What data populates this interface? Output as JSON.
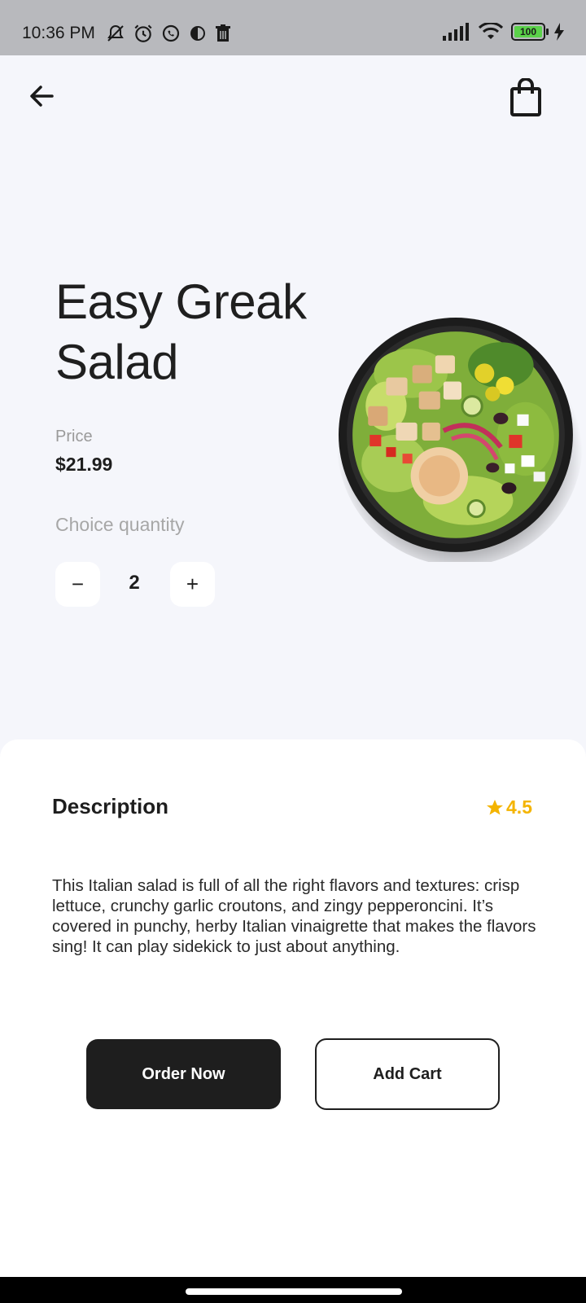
{
  "status_bar": {
    "time": "10:36 PM",
    "battery": "100",
    "icons_left": [
      "bell-off-icon",
      "alarm-icon",
      "whatsapp-icon",
      "data-saver-icon",
      "trash-icon"
    ],
    "icons_right": [
      "signal-icon",
      "wifi-icon",
      "battery-icon",
      "charging-icon"
    ]
  },
  "header": {
    "back_icon": "arrow-left-icon",
    "cart_icon": "shopping-bag-icon"
  },
  "product": {
    "title_line1": "Easy Greak",
    "title_line2": "Salad",
    "price_label": "Price",
    "price": "$21.99",
    "quantity_label": "Choice quantity",
    "quantity": "2",
    "minus_symbol": "−",
    "plus_symbol": "+"
  },
  "description": {
    "title": "Description",
    "rating": "4.5",
    "text": "This Italian salad is full of all the right flavors and textures: crisp lettuce, crunchy garlic croutons, and zingy pepperoncini. It’s covered in punchy, herby Italian vinaigrette that makes the flavors sing! It can play sidekick to just about anything."
  },
  "actions": {
    "order_label": "Order Now",
    "cart_label": "Add Cart"
  },
  "colors": {
    "accent_star": "#f4b400",
    "primary_dark": "#1e1e1e",
    "background": "#f5f6fb"
  }
}
